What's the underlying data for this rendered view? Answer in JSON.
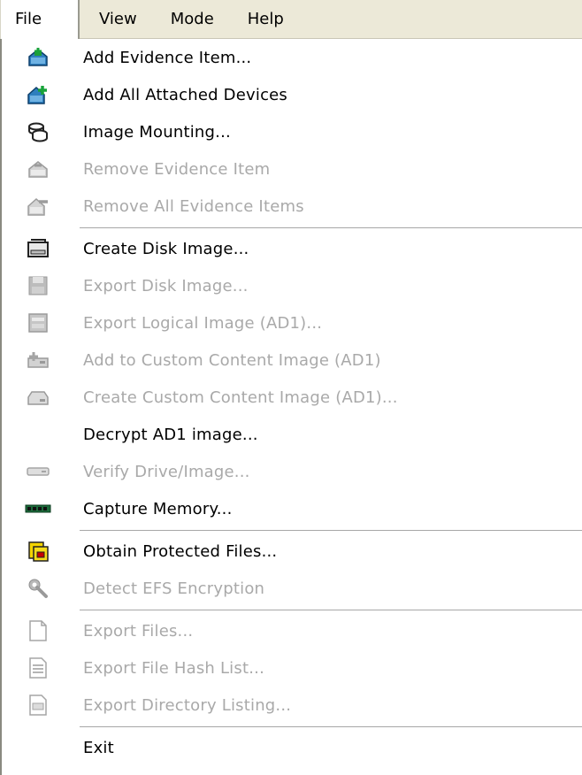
{
  "menubar": {
    "file": "File",
    "view": "View",
    "mode": "Mode",
    "help": "Help"
  },
  "menu": {
    "items": [
      {
        "label": "Add Evidence Item...",
        "enabled": true,
        "icon": "add-evidence-icon"
      },
      {
        "label": "Add All Attached Devices",
        "enabled": true,
        "icon": "add-devices-icon"
      },
      {
        "label": "Image Mounting...",
        "enabled": true,
        "icon": "image-mounting-icon"
      },
      {
        "label": "Remove Evidence Item",
        "enabled": false,
        "icon": "remove-evidence-icon"
      },
      {
        "label": "Remove All Evidence Items",
        "enabled": false,
        "icon": "remove-all-evidence-icon"
      },
      {
        "label": "Create Disk Image...",
        "enabled": true,
        "icon": "create-disk-image-icon"
      },
      {
        "label": "Export Disk Image...",
        "enabled": false,
        "icon": "export-disk-image-icon"
      },
      {
        "label": "Export Logical Image (AD1)...",
        "enabled": false,
        "icon": "export-logical-image-icon"
      },
      {
        "label": "Add to Custom Content Image (AD1)",
        "enabled": false,
        "icon": "add-custom-content-icon"
      },
      {
        "label": "Create Custom Content Image (AD1)...",
        "enabled": false,
        "icon": "create-custom-content-icon"
      },
      {
        "label": "Decrypt AD1 image...",
        "enabled": true,
        "icon": ""
      },
      {
        "label": "Verify Drive/Image...",
        "enabled": false,
        "icon": "verify-drive-icon"
      },
      {
        "label": "Capture Memory...",
        "enabled": true,
        "icon": "memory-chip-icon"
      },
      {
        "label": "Obtain Protected Files...",
        "enabled": true,
        "icon": "protected-files-icon"
      },
      {
        "label": "Detect EFS Encryption",
        "enabled": false,
        "icon": "wrench-icon"
      },
      {
        "label": "Export Files...",
        "enabled": false,
        "icon": "blank-page-icon"
      },
      {
        "label": "Export File Hash List...",
        "enabled": false,
        "icon": "hash-list-icon"
      },
      {
        "label": "Export Directory Listing...",
        "enabled": false,
        "icon": "directory-listing-icon"
      },
      {
        "label": "Exit",
        "enabled": true,
        "icon": ""
      }
    ]
  },
  "colors": {
    "enabled_text": "#000000",
    "disabled_text": "#a9a9a9",
    "menubar_bg": "#ece9d8"
  }
}
